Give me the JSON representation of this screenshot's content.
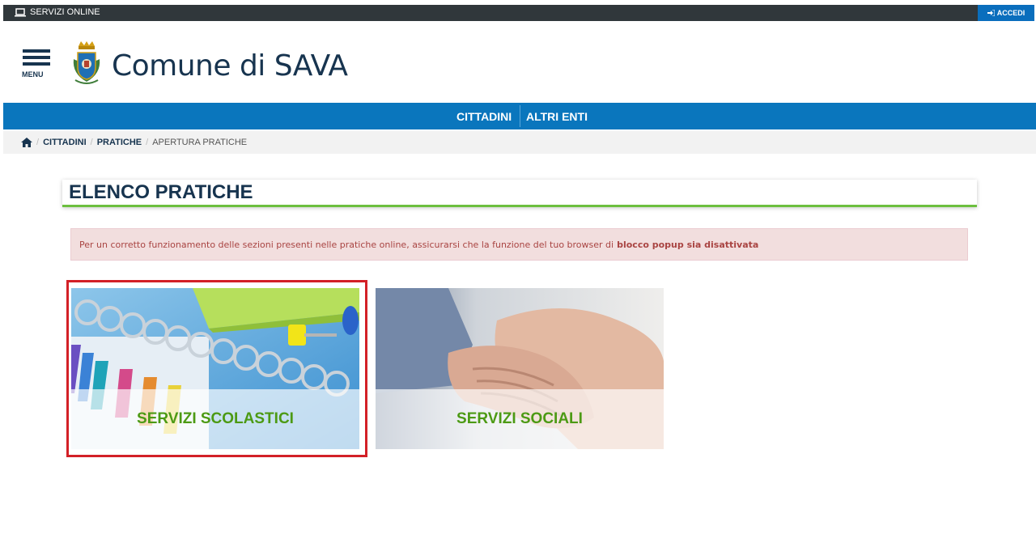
{
  "topbar": {
    "services_label": "SERVIZI ONLINE",
    "login_label": "ACCEDI"
  },
  "header": {
    "menu_label": "MENU",
    "site_title": "Comune di SAVA"
  },
  "nav": {
    "items": [
      {
        "label": "CITTADINI"
      },
      {
        "label": "ALTRI ENTI"
      }
    ]
  },
  "breadcrumb": {
    "items": [
      {
        "label": "CITTADINI"
      },
      {
        "label": "PRATICHE"
      },
      {
        "label": "APERTURA PRATICHE"
      }
    ]
  },
  "main": {
    "title": "ELENCO PRATICHE",
    "alert": {
      "text": "Per un corretto funzionamento delle sezioni presenti nelle pratiche online, assicurarsi che la funzione del tuo browser di",
      "emphasis": "blocco popup sia disattivata"
    },
    "cards": [
      {
        "label": "SERVIZI SCOLASTICI",
        "selected": true
      },
      {
        "label": "SERVIZI SOCIALI",
        "selected": false
      }
    ]
  },
  "colors": {
    "primary_blue": "#0a76bd",
    "dark_navy": "#17344f",
    "topbar": "#30373b",
    "accent_green": "#6cbf3f",
    "card_label_green": "#4c9a14",
    "selection_red": "#d32027",
    "alert_bg": "#f2dede",
    "alert_text": "#a94442"
  },
  "icons": {
    "services": "laptop-icon",
    "login": "sign-in-icon",
    "menu": "hamburger-icon",
    "breadcrumb_home": "home-icon",
    "crest": "municipal-crest-icon"
  }
}
